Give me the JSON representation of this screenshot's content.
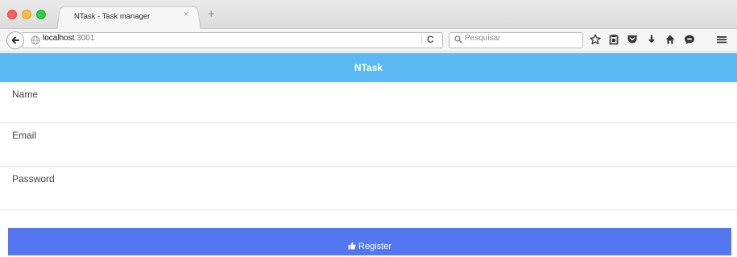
{
  "browser": {
    "tab": {
      "title": "NTask - Task manager",
      "close_glyph": "×",
      "new_tab_glyph": "+"
    },
    "toolbar": {
      "url_host": "localhost",
      "url_port": ":3001",
      "reload_glyph": "C",
      "search_placeholder": "Pesquisar",
      "icons": [
        "back-arrow-icon",
        "globe-icon",
        "reload-icon",
        "search-icon",
        "star-icon",
        "clipboard-icon",
        "pocket-icon",
        "download-icon",
        "home-icon",
        "chat-icon",
        "hamburger-menu-icon"
      ]
    },
    "window_controls": [
      "close",
      "minimize",
      "zoom"
    ]
  },
  "app": {
    "title": "NTask",
    "header_color": "#5bb9f3",
    "form": {
      "fields": [
        {
          "label": "Name",
          "value": ""
        },
        {
          "label": "Email",
          "value": ""
        },
        {
          "label": "Password",
          "value": ""
        }
      ],
      "submit_label": "Register",
      "submit_icon": "thumbs-up-icon",
      "submit_color": "#5277f1"
    }
  }
}
